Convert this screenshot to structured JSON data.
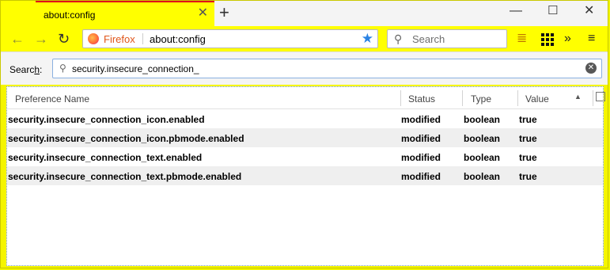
{
  "tab": {
    "title": "about:config",
    "close_icon": "close-icon"
  },
  "window_controls": {
    "minimize": "minimize-icon",
    "maximize": "maximize-icon",
    "close": "close-icon"
  },
  "nav": {
    "identity_label": "Firefox",
    "url": "about:config",
    "search_placeholder": "Search"
  },
  "filter": {
    "label_prefix": "Searc",
    "label_accel": "h",
    "label_suffix": ":",
    "value": "security.insecure_connection_"
  },
  "table": {
    "columns": [
      "Preference Name",
      "Status",
      "Type",
      "Value"
    ],
    "rows": [
      {
        "name": "security.insecure_connection_icon.enabled",
        "status": "modified",
        "type": "boolean",
        "value": "true"
      },
      {
        "name": "security.insecure_connection_icon.pbmode.enabled",
        "status": "modified",
        "type": "boolean",
        "value": "true"
      },
      {
        "name": "security.insecure_connection_text.enabled",
        "status": "modified",
        "type": "boolean",
        "value": "true"
      },
      {
        "name": "security.insecure_connection_text.pbmode.enabled",
        "status": "modified",
        "type": "boolean",
        "value": "true"
      }
    ]
  },
  "colors": {
    "toolbar": "#ffff00",
    "tab_accent": "#e0001b",
    "star": "#2a82e4",
    "firefox_label": "#e0561c"
  }
}
